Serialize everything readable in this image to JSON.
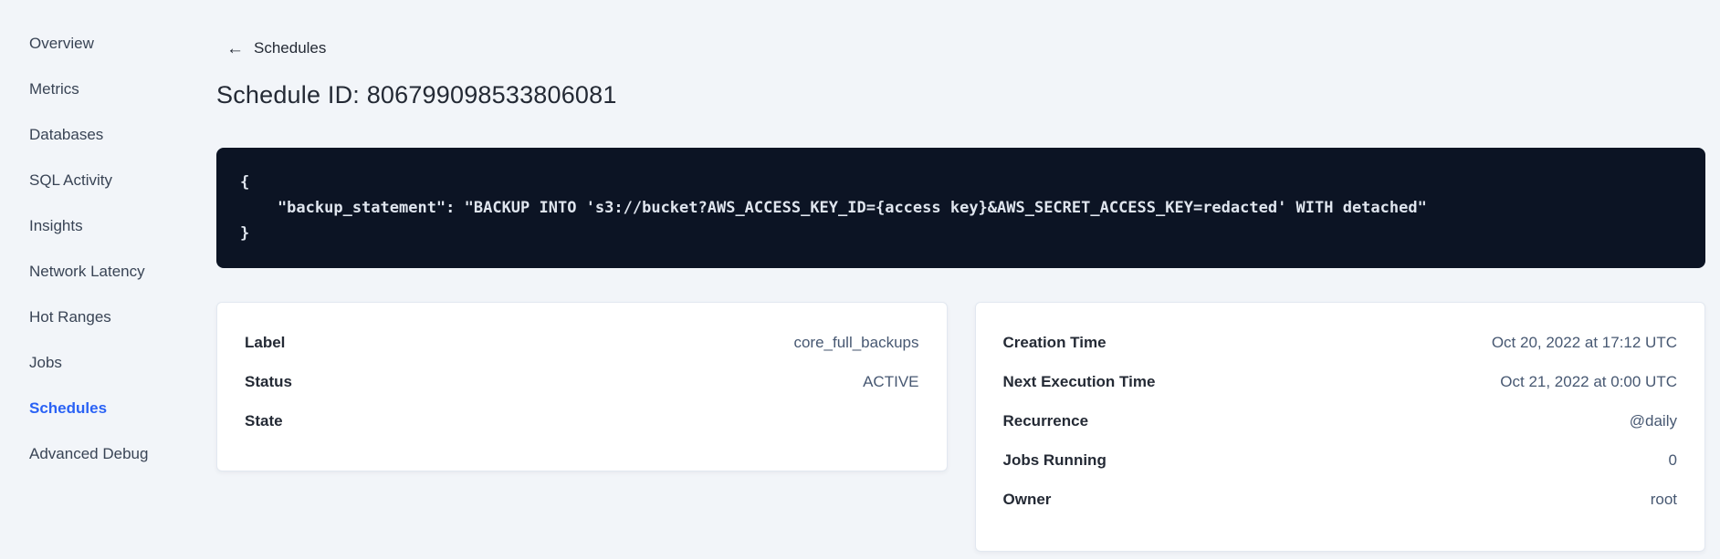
{
  "colors": {
    "accent": "#2a62f5",
    "code_bg": "#0c1424",
    "code_text": "#dfe5ee",
    "page_bg": "#f2f5f9"
  },
  "sidebar": {
    "items": [
      {
        "label": "Overview",
        "active": false
      },
      {
        "label": "Metrics",
        "active": false
      },
      {
        "label": "Databases",
        "active": false
      },
      {
        "label": "SQL Activity",
        "active": false
      },
      {
        "label": "Insights",
        "active": false
      },
      {
        "label": "Network Latency",
        "active": false
      },
      {
        "label": "Hot Ranges",
        "active": false
      },
      {
        "label": "Jobs",
        "active": false
      },
      {
        "label": "Schedules",
        "active": true
      },
      {
        "label": "Advanced Debug",
        "active": false
      }
    ]
  },
  "header": {
    "back_icon": "←",
    "back_label": "Schedules",
    "title": "Schedule ID: 806799098533806081"
  },
  "code_block": {
    "lines": [
      "{",
      "    \"backup_statement\": \"BACKUP INTO 's3://bucket?AWS_ACCESS_KEY_ID={access key}&AWS_SECRET_ACCESS_KEY=redacted' WITH detached\"",
      "}"
    ]
  },
  "left_card": {
    "rows": [
      {
        "label": "Label",
        "value": "core_full_backups"
      },
      {
        "label": "Status",
        "value": "ACTIVE"
      },
      {
        "label": "State",
        "value": ""
      }
    ]
  },
  "right_card": {
    "rows": [
      {
        "label": "Creation Time",
        "value": "Oct 20, 2022 at 17:12 UTC"
      },
      {
        "label": "Next Execution Time",
        "value": "Oct 21, 2022 at 0:00 UTC"
      },
      {
        "label": "Recurrence",
        "value": "@daily"
      },
      {
        "label": "Jobs Running",
        "value": "0"
      },
      {
        "label": "Owner",
        "value": "root"
      }
    ]
  }
}
